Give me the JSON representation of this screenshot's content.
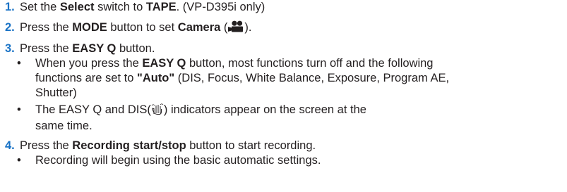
{
  "steps": [
    {
      "number": "1.",
      "parts": [
        "Set the ",
        "Select",
        " switch to ",
        "TAPE",
        ". (VP-D395i only)"
      ]
    },
    {
      "number": "2.",
      "parts": [
        "Press the ",
        "MODE",
        " button to set ",
        "Camera",
        " (",
        ")."
      ],
      "icon": "movie-camera-icon"
    },
    {
      "number": "3.",
      "parts": [
        "Press the ",
        "EASY Q",
        " button."
      ],
      "bullets": [
        {
          "bullet": "•",
          "parts": [
            "When you press the ",
            "EASY Q",
            " button, most functions turn off and the following",
            "functions are set to ",
            "\"Auto\"",
            " (DIS, Focus, White Balance, Exposure, Program AE,",
            "Shutter)"
          ]
        },
        {
          "bullet": "•",
          "parts": [
            "The EASY Q and DIS(",
            ") indicators appear on the screen at the",
            "same time."
          ],
          "icon": "dis-hand-icon"
        }
      ]
    },
    {
      "number": "4.",
      "parts": [
        "Press the ",
        "Recording start/stop",
        " button to start recording."
      ],
      "bullets": [
        {
          "bullet": "•",
          "parts": [
            "Recording will begin using the basic automatic settings."
          ]
        }
      ]
    }
  ],
  "colors": {
    "number": "#1a73c6",
    "text": "#231f20"
  }
}
